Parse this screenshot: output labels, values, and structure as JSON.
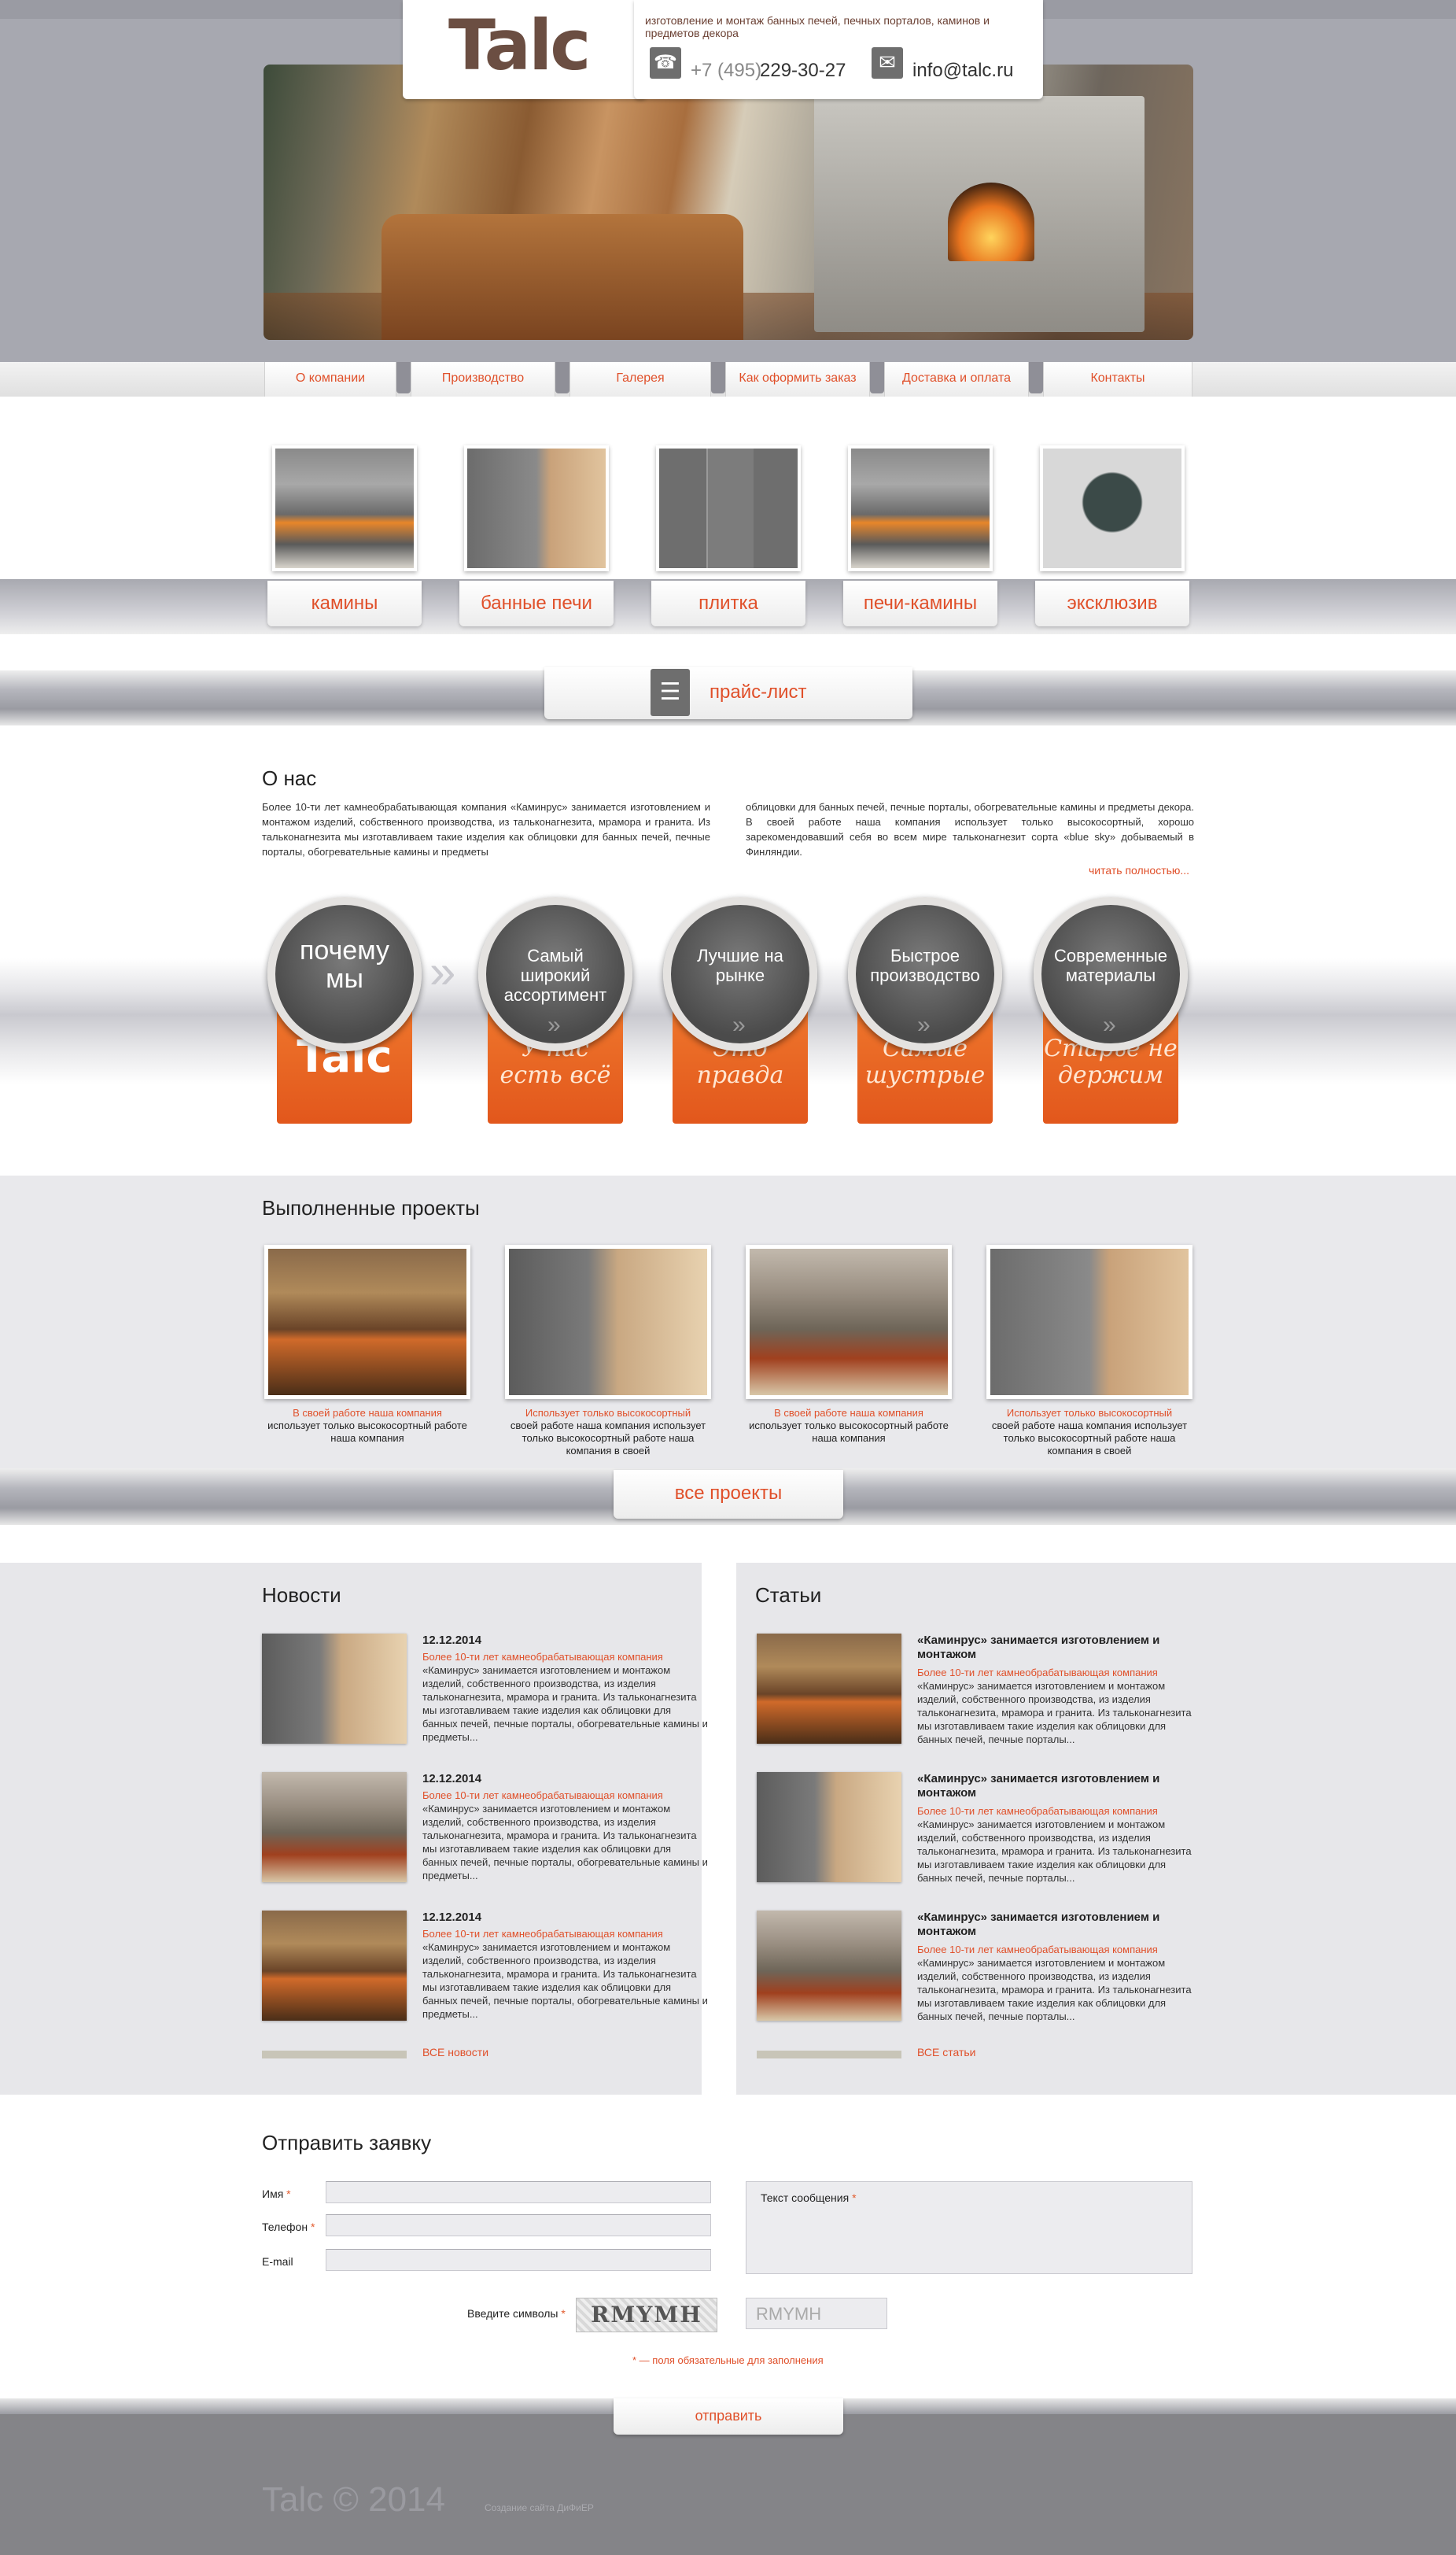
{
  "header": {
    "logo": "Talc",
    "tagline": "изготовление и монтаж банных печей, печных порталов, каминов и предметов декора",
    "phone_prefix": "+7 (495)",
    "phone_number": "229-30-27",
    "email": "info@talc.ru"
  },
  "nav": [
    "О компании",
    "Производство",
    "Галерея",
    "Как оформить заказ",
    "Доставка и оплата",
    "Контакты"
  ],
  "categories": [
    "камины",
    "банные печи",
    "плитка",
    "печи-камины",
    "эксклюзив"
  ],
  "price_list": "прайс-лист",
  "about": {
    "title": "О нас",
    "col1": "Более 10-ти лет камнеобрабатывающая компания «Каминрус» занимается изготовлением и монтажом изделий, собственного производства, из тальконагнезита, мрамора и гранита. Из тальконагнезита мы изготавливаем такие изделия как облицовки для банных печей, печные порталы, обогревательные камины и предметы",
    "col2": "облицовки для банных печей, печные порталы, обогревательные камины и предметы декора. В своей работе наша компания использует только высокосортный, хорошо зарекомендовавший себя во всем мире тальконагнезит сорта «blue sky» добываемый в Финляндии.",
    "more": "читать полностью..."
  },
  "why": {
    "first_circle": "почему мы",
    "first_ribbon": "Talc",
    "items": [
      {
        "circle": "Самый широкий ассортимент",
        "ribbon": "У нас есть всё"
      },
      {
        "circle": "Лучшие на рынке",
        "ribbon": "Это правда"
      },
      {
        "circle": "Быстрое производство",
        "ribbon": "Самые шустрые"
      },
      {
        "circle": "Современные материалы",
        "ribbon": "Старьё не держим"
      }
    ]
  },
  "projects": {
    "title": "Выполненные проекты",
    "items": [
      {
        "title": "В своей работе наша компания",
        "desc": "использует только высокосортный работе наша компания"
      },
      {
        "title": "Использует только высокосортный",
        "desc": "своей работе наша компания использует только высокосортный работе наша компания в своей"
      },
      {
        "title": "В своей работе наша компания",
        "desc": "использует только высокосортный работе наша компания"
      },
      {
        "title": "Использует только высокосортный",
        "desc": "своей работе наша компания использует только высокосортный работе наша компания в своей"
      }
    ],
    "all_label": "все проекты"
  },
  "news": {
    "title": "Новости",
    "items": [
      {
        "date": "12.12.2014",
        "sub": "Более 10-ти лет камнеобрабатывающая компания",
        "text": "«Каминрус» занимается изготовлением и монтажом изделий, собственного производства, из изделия тальконагнезита, мрамора и гранита. Из тальконагнезита мы изготавливаем такие изделия как облицовки для банных печей, печные порталы, обогревательные камины и предметы..."
      },
      {
        "date": "12.12.2014",
        "sub": "Более 10-ти лет камнеобрабатывающая компания",
        "text": "«Каминрус» занимается изготовлением и монтажом изделий, собственного производства, из изделия тальконагнезита, мрамора и гранита. Из тальконагнезита мы изготавливаем такие изделия как облицовки для банных печей, печные порталы, обогревательные камины и предметы..."
      },
      {
        "date": "12.12.2014",
        "sub": "Более 10-ти лет камнеобрабатывающая компания",
        "text": "«Каминрус» занимается изготовлением и монтажом изделий, собственного производства, из изделия тальконагнезита, мрамора и гранита. Из тальконагнезита мы изготавливаем такие изделия как облицовки для банных печей, печные порталы, обогревательные камины и предметы..."
      }
    ],
    "all_label": "ВСЕ новости"
  },
  "articles": {
    "title": "Статьи",
    "items": [
      {
        "head": "«Каминрус» занимается изготовлением и монтажом",
        "sub": "Более 10-ти лет камнеобрабатывающая компания",
        "text": "«Каминрус» занимается изготовлением и монтажом изделий, собственного производства, из изделия тальконагнезита, мрамора и гранита. Из тальконагнезита мы изготавливаем такие изделия как облицовки для банных печей, печные порталы..."
      },
      {
        "head": "«Каминрус» занимается изготовлением и монтажом",
        "sub": "Более 10-ти лет камнеобрабатывающая компания",
        "text": "«Каминрус» занимается изготовлением и монтажом изделий, собственного производства, из изделия тальконагнезита, мрамора и гранита. Из тальконагнезита мы изготавливаем такие изделия как облицовки для банных печей, печные порталы..."
      },
      {
        "head": "«Каминрус» занимается изготовлением и монтажом",
        "sub": "Более 10-ти лет камнеобрабатывающая компания",
        "text": "«Каминрус» занимается изготовлением и монтажом изделий, собственного производства, из изделия тальконагнезита, мрамора и гранита. Из тальконагнезита мы изготавливаем такие изделия как облицовки для банных печей, печные порталы..."
      }
    ],
    "all_label": "ВСЕ статьи"
  },
  "form": {
    "title": "Отправить заявку",
    "name_label": "Имя",
    "phone_label": "Телефон",
    "email_label": "E-mail",
    "message_label": "Текст сообщения",
    "captcha_label": "Введите символы",
    "captcha_image_text": "RMYMH",
    "captcha_value": "RMYMH",
    "required_mark": "*",
    "required_note": "* — поля обязательные для заполнения",
    "submit": "отправить"
  },
  "footer": {
    "copyright": "Talc © 2014",
    "developer": "Создание сайта ДиФиЕР"
  }
}
